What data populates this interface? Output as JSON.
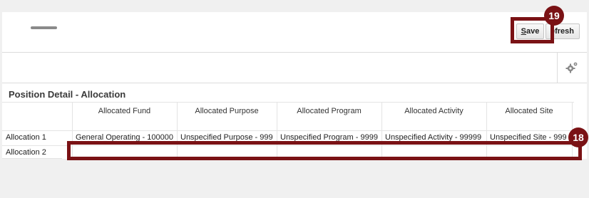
{
  "toolbar": {
    "save_label_underlined": "S",
    "save_label_rest": "ave",
    "refresh_label": "efresh"
  },
  "section": {
    "title": "Position Detail - Allocation"
  },
  "table": {
    "columns": [
      "Allocated Fund",
      "Allocated Purpose",
      "Allocated Program",
      "Allocated Activity",
      "Allocated Site"
    ],
    "rows": [
      {
        "label": "Allocation 1",
        "cells": [
          "General Operating - 100000",
          "Unspecified Purpose - 999",
          "Unspecified Program - 9999",
          "Unspecified Activity - 99999",
          "Unspecified Site - 999"
        ]
      },
      {
        "label": "Allocation 2",
        "cells": [
          "",
          "",
          "",
          "",
          ""
        ]
      }
    ]
  },
  "callouts": {
    "save_step": "19",
    "row_step": "18"
  },
  "colors": {
    "callout": "#7a1215"
  },
  "icons": {
    "settings": "gear-icon",
    "drag": "drag-handle-icon"
  }
}
